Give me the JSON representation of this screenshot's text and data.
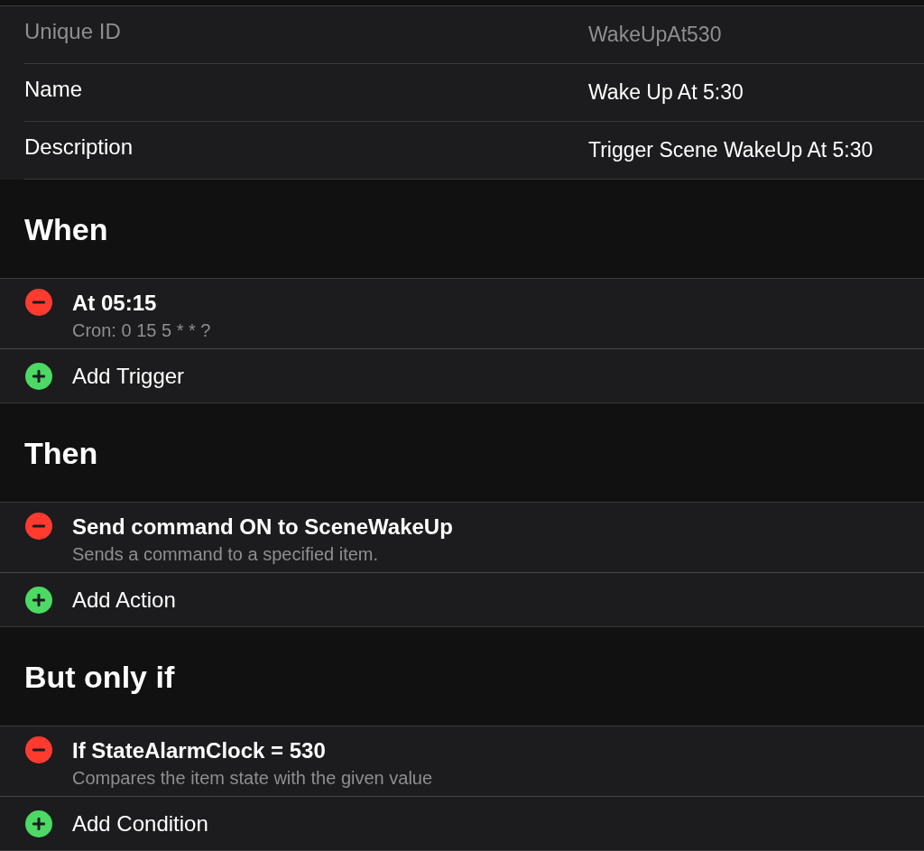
{
  "fields": [
    {
      "label": "Unique ID",
      "value": "WakeUpAt530",
      "disabled": true
    },
    {
      "label": "Name",
      "value": "Wake Up At 5:30",
      "disabled": false
    },
    {
      "label": "Description",
      "value": "Trigger Scene WakeUp At 5:30",
      "disabled": false
    }
  ],
  "sections": [
    {
      "title": "When",
      "items": [
        {
          "title": "At 05:15",
          "subtitle": "Cron: 0 15 5 * * ?"
        }
      ],
      "add_label": "Add Trigger"
    },
    {
      "title": "Then",
      "items": [
        {
          "title": "Send command ON to SceneWakeUp",
          "subtitle": "Sends a command to a specified item."
        }
      ],
      "add_label": "Add Action"
    },
    {
      "title": "But only if",
      "items": [
        {
          "title": "If StateAlarmClock = 530",
          "subtitle": "Compares the item state with the given value"
        }
      ],
      "add_label": "Add Condition"
    }
  ]
}
